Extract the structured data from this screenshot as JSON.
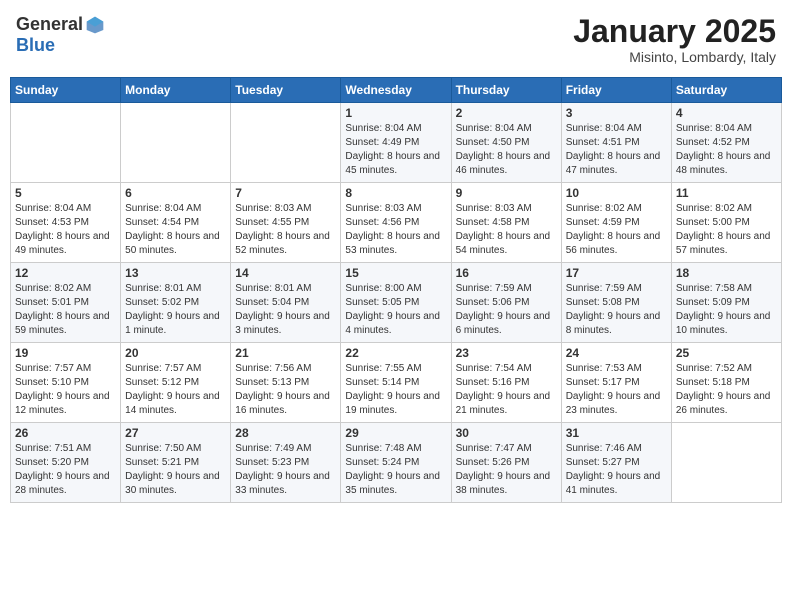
{
  "header": {
    "logo_general": "General",
    "logo_blue": "Blue",
    "month_title": "January 2025",
    "location": "Misinto, Lombardy, Italy"
  },
  "weekdays": [
    "Sunday",
    "Monday",
    "Tuesday",
    "Wednesday",
    "Thursday",
    "Friday",
    "Saturday"
  ],
  "weeks": [
    [
      {
        "day": "",
        "info": ""
      },
      {
        "day": "",
        "info": ""
      },
      {
        "day": "",
        "info": ""
      },
      {
        "day": "1",
        "info": "Sunrise: 8:04 AM\nSunset: 4:49 PM\nDaylight: 8 hours and 45 minutes."
      },
      {
        "day": "2",
        "info": "Sunrise: 8:04 AM\nSunset: 4:50 PM\nDaylight: 8 hours and 46 minutes."
      },
      {
        "day": "3",
        "info": "Sunrise: 8:04 AM\nSunset: 4:51 PM\nDaylight: 8 hours and 47 minutes."
      },
      {
        "day": "4",
        "info": "Sunrise: 8:04 AM\nSunset: 4:52 PM\nDaylight: 8 hours and 48 minutes."
      }
    ],
    [
      {
        "day": "5",
        "info": "Sunrise: 8:04 AM\nSunset: 4:53 PM\nDaylight: 8 hours and 49 minutes."
      },
      {
        "day": "6",
        "info": "Sunrise: 8:04 AM\nSunset: 4:54 PM\nDaylight: 8 hours and 50 minutes."
      },
      {
        "day": "7",
        "info": "Sunrise: 8:03 AM\nSunset: 4:55 PM\nDaylight: 8 hours and 52 minutes."
      },
      {
        "day": "8",
        "info": "Sunrise: 8:03 AM\nSunset: 4:56 PM\nDaylight: 8 hours and 53 minutes."
      },
      {
        "day": "9",
        "info": "Sunrise: 8:03 AM\nSunset: 4:58 PM\nDaylight: 8 hours and 54 minutes."
      },
      {
        "day": "10",
        "info": "Sunrise: 8:02 AM\nSunset: 4:59 PM\nDaylight: 8 hours and 56 minutes."
      },
      {
        "day": "11",
        "info": "Sunrise: 8:02 AM\nSunset: 5:00 PM\nDaylight: 8 hours and 57 minutes."
      }
    ],
    [
      {
        "day": "12",
        "info": "Sunrise: 8:02 AM\nSunset: 5:01 PM\nDaylight: 8 hours and 59 minutes."
      },
      {
        "day": "13",
        "info": "Sunrise: 8:01 AM\nSunset: 5:02 PM\nDaylight: 9 hours and 1 minute."
      },
      {
        "day": "14",
        "info": "Sunrise: 8:01 AM\nSunset: 5:04 PM\nDaylight: 9 hours and 3 minutes."
      },
      {
        "day": "15",
        "info": "Sunrise: 8:00 AM\nSunset: 5:05 PM\nDaylight: 9 hours and 4 minutes."
      },
      {
        "day": "16",
        "info": "Sunrise: 7:59 AM\nSunset: 5:06 PM\nDaylight: 9 hours and 6 minutes."
      },
      {
        "day": "17",
        "info": "Sunrise: 7:59 AM\nSunset: 5:08 PM\nDaylight: 9 hours and 8 minutes."
      },
      {
        "day": "18",
        "info": "Sunrise: 7:58 AM\nSunset: 5:09 PM\nDaylight: 9 hours and 10 minutes."
      }
    ],
    [
      {
        "day": "19",
        "info": "Sunrise: 7:57 AM\nSunset: 5:10 PM\nDaylight: 9 hours and 12 minutes."
      },
      {
        "day": "20",
        "info": "Sunrise: 7:57 AM\nSunset: 5:12 PM\nDaylight: 9 hours and 14 minutes."
      },
      {
        "day": "21",
        "info": "Sunrise: 7:56 AM\nSunset: 5:13 PM\nDaylight: 9 hours and 16 minutes."
      },
      {
        "day": "22",
        "info": "Sunrise: 7:55 AM\nSunset: 5:14 PM\nDaylight: 9 hours and 19 minutes."
      },
      {
        "day": "23",
        "info": "Sunrise: 7:54 AM\nSunset: 5:16 PM\nDaylight: 9 hours and 21 minutes."
      },
      {
        "day": "24",
        "info": "Sunrise: 7:53 AM\nSunset: 5:17 PM\nDaylight: 9 hours and 23 minutes."
      },
      {
        "day": "25",
        "info": "Sunrise: 7:52 AM\nSunset: 5:18 PM\nDaylight: 9 hours and 26 minutes."
      }
    ],
    [
      {
        "day": "26",
        "info": "Sunrise: 7:51 AM\nSunset: 5:20 PM\nDaylight: 9 hours and 28 minutes."
      },
      {
        "day": "27",
        "info": "Sunrise: 7:50 AM\nSunset: 5:21 PM\nDaylight: 9 hours and 30 minutes."
      },
      {
        "day": "28",
        "info": "Sunrise: 7:49 AM\nSunset: 5:23 PM\nDaylight: 9 hours and 33 minutes."
      },
      {
        "day": "29",
        "info": "Sunrise: 7:48 AM\nSunset: 5:24 PM\nDaylight: 9 hours and 35 minutes."
      },
      {
        "day": "30",
        "info": "Sunrise: 7:47 AM\nSunset: 5:26 PM\nDaylight: 9 hours and 38 minutes."
      },
      {
        "day": "31",
        "info": "Sunrise: 7:46 AM\nSunset: 5:27 PM\nDaylight: 9 hours and 41 minutes."
      },
      {
        "day": "",
        "info": ""
      }
    ]
  ]
}
